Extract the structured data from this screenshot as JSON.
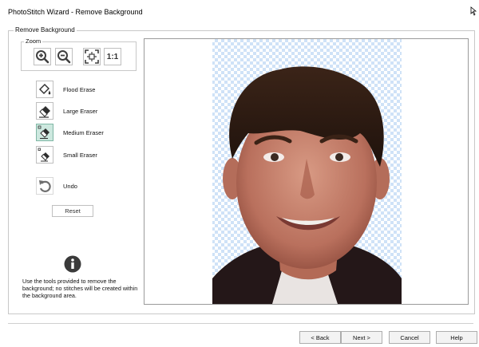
{
  "window": {
    "title": "PhotoStitch Wizard - Remove Background"
  },
  "group": {
    "label": "Remove Background"
  },
  "zoom": {
    "label": "Zoom",
    "buttons": [
      {
        "name": "zoom-in",
        "icon": "zoom-in-icon"
      },
      {
        "name": "zoom-out",
        "icon": "zoom-out-icon"
      },
      {
        "name": "fit",
        "icon": "fit-to-window-icon"
      },
      {
        "name": "actual-size",
        "icon": "actual-size-icon",
        "text": "1:1"
      }
    ]
  },
  "tools": [
    {
      "label": "Flood Erase",
      "icon": "flood-erase-icon",
      "active": false
    },
    {
      "label": "Large Eraser",
      "icon": "eraser-icon",
      "active": false
    },
    {
      "label": "Medium Eraser",
      "icon": "eraser-icon",
      "active": true
    },
    {
      "label": "Small Eraser",
      "icon": "eraser-icon",
      "active": false
    }
  ],
  "undo": {
    "label": "Undo",
    "icon": "undo-icon"
  },
  "reset": {
    "label": "Reset"
  },
  "info": {
    "icon": "info-icon",
    "text": "Use the tools provided to remove the background; no stitches will be created within the background area."
  },
  "footer": {
    "back": "< Back",
    "next": "Next >",
    "cancel": "Cancel",
    "help": "Help"
  },
  "colors": {
    "accent_active": "#cde8df",
    "checker_blue": "#cfe2f7",
    "icon_dark": "#3f3f3f"
  }
}
